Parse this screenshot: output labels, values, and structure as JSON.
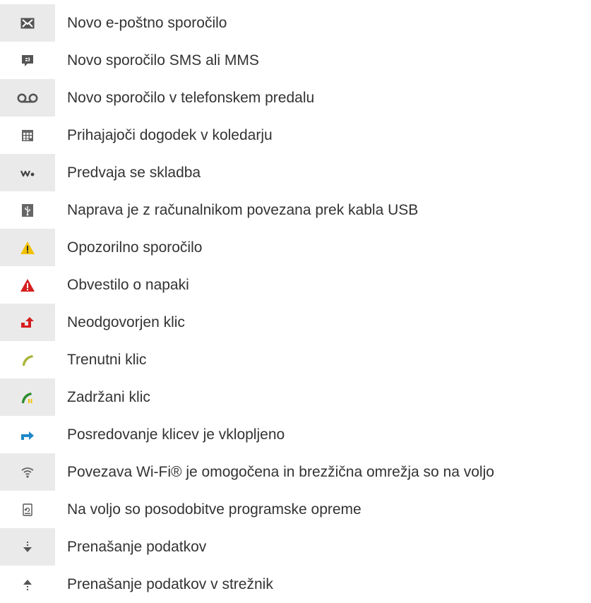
{
  "items": [
    {
      "icon": "email-icon",
      "label": "Novo e-poštno sporočilo"
    },
    {
      "icon": "sms-icon",
      "label": "Novo sporočilo SMS ali MMS"
    },
    {
      "icon": "voicemail-icon",
      "label": "Novo sporočilo v telefonskem predalu"
    },
    {
      "icon": "calendar-icon",
      "label": "Prihajajoči dogodek v koledarju"
    },
    {
      "icon": "walkman-icon",
      "label": "Predvaja se skladba"
    },
    {
      "icon": "usb-icon",
      "label": "Naprava je z računalnikom povezana prek kabla USB"
    },
    {
      "icon": "warning-icon",
      "label": "Opozorilno sporočilo"
    },
    {
      "icon": "error-icon",
      "label": "Obvestilo o napaki"
    },
    {
      "icon": "missed-call-icon",
      "label": "Neodgovorjen klic"
    },
    {
      "icon": "ongoing-call-icon",
      "label": "Trenutni klic"
    },
    {
      "icon": "call-on-hold-icon",
      "label": "Zadržani klic"
    },
    {
      "icon": "call-forward-icon",
      "label": "Posredovanje klicev je vklopljeno"
    },
    {
      "icon": "wifi-icon",
      "label": "Povezava Wi-Fi® je omogočena in brezžična omrežja so na voljo"
    },
    {
      "icon": "software-update-icon",
      "label": "Na voljo so posodobitve programske opreme"
    },
    {
      "icon": "download-icon",
      "label": "Prenašanje podatkov"
    },
    {
      "icon": "upload-icon",
      "label": "Prenašanje podatkov v strežnik"
    }
  ],
  "colors": {
    "icon_gray": "#555555",
    "warning_yellow": "#f2c200",
    "error_red": "#d61f1f",
    "call_green": "#2e8b2e",
    "call_yellowgreen": "#a9b53a",
    "forward_blue": "#1e88c8",
    "row_shade": "#eaeaea"
  }
}
